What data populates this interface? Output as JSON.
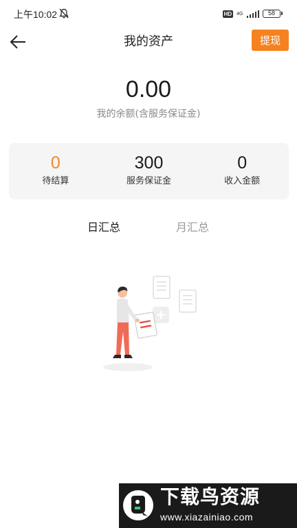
{
  "status_bar": {
    "time": "上午10:02",
    "hd": "HD",
    "network": "4G",
    "battery": "58"
  },
  "header": {
    "title": "我的资产",
    "withdraw_label": "提现"
  },
  "balance": {
    "value": "0.00",
    "label": "我的余额(含服务保证金)"
  },
  "stats": [
    {
      "value": "0",
      "label": "待结算",
      "color": "#f08a24"
    },
    {
      "value": "300",
      "label": "服务保证金",
      "color": "#1a1a1a"
    },
    {
      "value": "0",
      "label": "收入金额",
      "color": "#1a1a1a"
    }
  ],
  "tabs": [
    {
      "label": "日汇总",
      "active": true
    },
    {
      "label": "月汇总",
      "active": false
    }
  ],
  "watermark": {
    "title": "下载鸟资源",
    "url": "www.xiazainiao.com"
  },
  "colors": {
    "accent": "#f5821f",
    "pending": "#f08a24",
    "card_bg": "#f5f5f5"
  }
}
